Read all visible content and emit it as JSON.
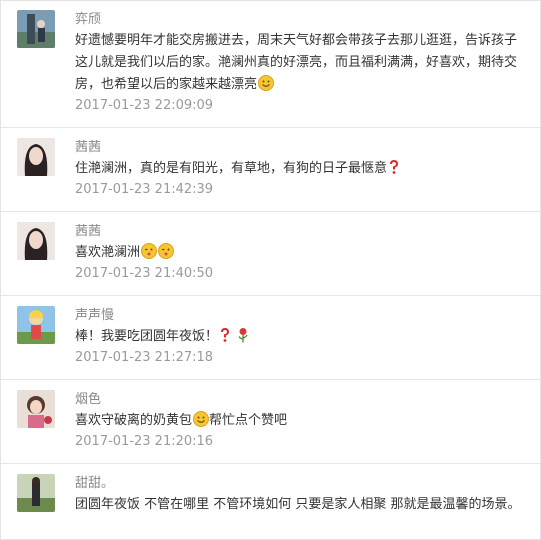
{
  "comments": [
    {
      "name": "弈颀",
      "text": "好遗憾要明年才能交房搬进去，周末天气好都会带孩子去那儿逛逛，告诉孩子这儿就是我们以后的家。滟澜州真的好漂亮，而且福利满满，好喜欢，期待交房，也希望以后的家越来越漂亮",
      "time": "2017-01-23 22:09:09"
    },
    {
      "name": "茜茜",
      "text": "住滟澜洲，真的是有阳光，有草地，有狗的日子最惬意",
      "time": "2017-01-23 21:42:39"
    },
    {
      "name": "茜茜",
      "text": "喜欢滟澜洲",
      "time": "2017-01-23 21:40:50"
    },
    {
      "name": "声声慢",
      "text": "棒！我要吃团圆年夜饭！",
      "time": "2017-01-23 21:27:18"
    },
    {
      "name": "烟色",
      "text": "喜欢守破离的奶黄包",
      "text_after": "帮忙点个赞吧",
      "time": "2017-01-23 21:20:16"
    },
    {
      "name": "甜甜。",
      "text": "团圆年夜饭 不管在哪里 不管环境如何 只要是家人相聚 那就是最温馨的场景。",
      "time": ""
    }
  ],
  "icons": {
    "smile": "smile-emoji",
    "question": "red-question-mark",
    "kiss": "kiss-emoji",
    "rose": "rose-emoji"
  }
}
